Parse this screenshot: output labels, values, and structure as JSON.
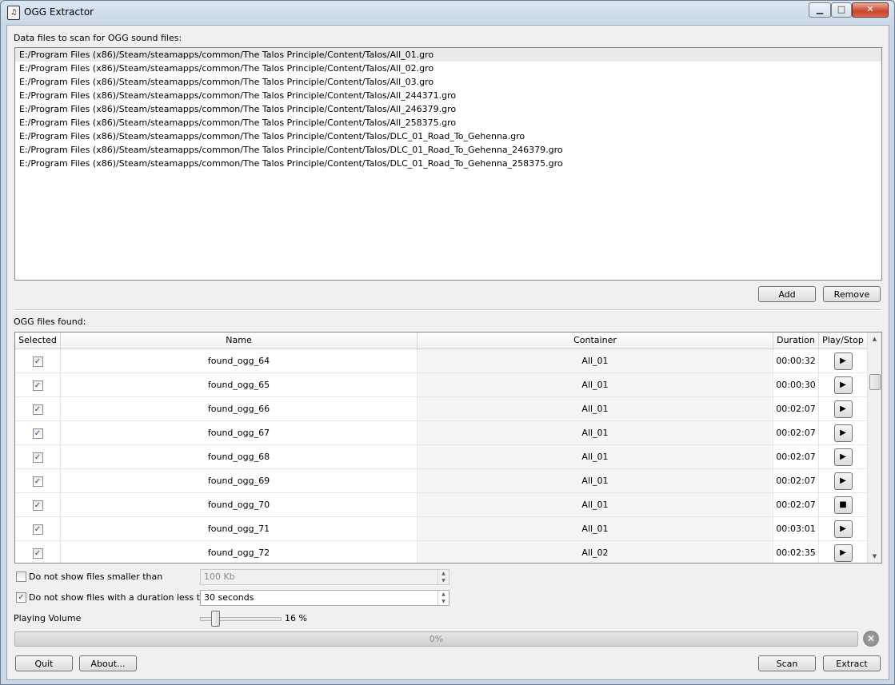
{
  "window": {
    "title": "OGG Extractor",
    "app_icon": "ogg-file-icon",
    "minimize": "minimize-icon",
    "maximize": "maximize-icon",
    "close": "close-icon"
  },
  "data_files": {
    "label": "Data files to scan for OGG sound files:",
    "items": [
      "E:/Program Files (x86)/Steam/steamapps/common/The Talos Principle/Content/Talos/All_01.gro",
      "E:/Program Files (x86)/Steam/steamapps/common/The Talos Principle/Content/Talos/All_02.gro",
      "E:/Program Files (x86)/Steam/steamapps/common/The Talos Principle/Content/Talos/All_03.gro",
      "E:/Program Files (x86)/Steam/steamapps/common/The Talos Principle/Content/Talos/All_244371.gro",
      "E:/Program Files (x86)/Steam/steamapps/common/The Talos Principle/Content/Talos/All_246379.gro",
      "E:/Program Files (x86)/Steam/steamapps/common/The Talos Principle/Content/Talos/All_258375.gro",
      "E:/Program Files (x86)/Steam/steamapps/common/The Talos Principle/Content/Talos/DLC_01_Road_To_Gehenna.gro",
      "E:/Program Files (x86)/Steam/steamapps/common/The Talos Principle/Content/Talos/DLC_01_Road_To_Gehenna_246379.gro",
      "E:/Program Files (x86)/Steam/steamapps/common/The Talos Principle/Content/Talos/DLC_01_Road_To_Gehenna_258375.gro"
    ],
    "add_label": "Add",
    "remove_label": "Remove"
  },
  "ogg_files": {
    "label": "OGG files found:",
    "columns": [
      "Selected",
      "Name",
      "Container",
      "Duration",
      "Play/Stop"
    ],
    "rows": [
      {
        "selected": true,
        "name": "found_ogg_64",
        "container": "All_01",
        "duration": "00:00:32",
        "action": "play"
      },
      {
        "selected": true,
        "name": "found_ogg_65",
        "container": "All_01",
        "duration": "00:00:30",
        "action": "play"
      },
      {
        "selected": true,
        "name": "found_ogg_66",
        "container": "All_01",
        "duration": "00:02:07",
        "action": "play"
      },
      {
        "selected": true,
        "name": "found_ogg_67",
        "container": "All_01",
        "duration": "00:02:07",
        "action": "play"
      },
      {
        "selected": true,
        "name": "found_ogg_68",
        "container": "All_01",
        "duration": "00:02:07",
        "action": "play"
      },
      {
        "selected": true,
        "name": "found_ogg_69",
        "container": "All_01",
        "duration": "00:02:07",
        "action": "play"
      },
      {
        "selected": true,
        "name": "found_ogg_70",
        "container": "All_01",
        "duration": "00:02:07",
        "action": "stop"
      },
      {
        "selected": true,
        "name": "found_ogg_71",
        "container": "All_01",
        "duration": "00:03:01",
        "action": "play"
      },
      {
        "selected": true,
        "name": "found_ogg_72",
        "container": "All_02",
        "duration": "00:02:35",
        "action": "play"
      }
    ]
  },
  "filters": {
    "size": {
      "checked": false,
      "label": "Do not show files smaller than",
      "value": "100 Kb",
      "enabled": false
    },
    "duration": {
      "checked": true,
      "label": "Do not show files with a duration less than",
      "value": "30 seconds",
      "enabled": true
    }
  },
  "volume": {
    "label": "Playing Volume",
    "value_text": "16 %",
    "level": 0.16
  },
  "progress": {
    "text": "0%",
    "value": 0
  },
  "buttons": {
    "quit": "Quit",
    "about": "About...",
    "scan": "Scan",
    "extract": "Extract"
  }
}
